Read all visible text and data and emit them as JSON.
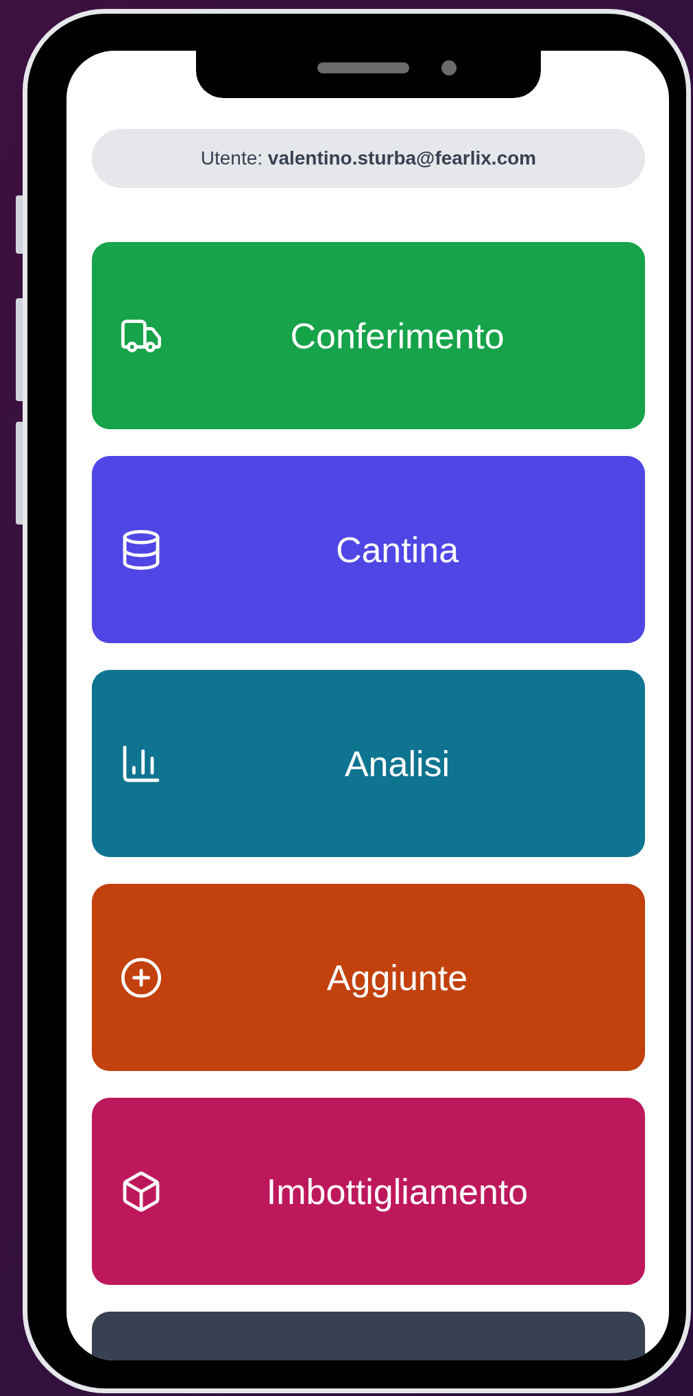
{
  "user_bar": {
    "text": "Utente: **valentino.sturba@fearlix.com**"
  },
  "menu": [
    {
      "label": "Conferimento",
      "kind": "truck",
      "color": "#16a34a"
    },
    {
      "label": "Cantina",
      "kind": "database",
      "color": "#4f46e5"
    },
    {
      "label": "Analisi",
      "kind": "chart",
      "color": "#0e7490"
    },
    {
      "label": "Aggiunte",
      "kind": "plus",
      "color": "#c2410c"
    },
    {
      "label": "Imbottigliamento",
      "kind": "box",
      "color": "#be185d"
    },
    {
      "kind": "blank",
      "color": "#374151"
    }
  ]
}
